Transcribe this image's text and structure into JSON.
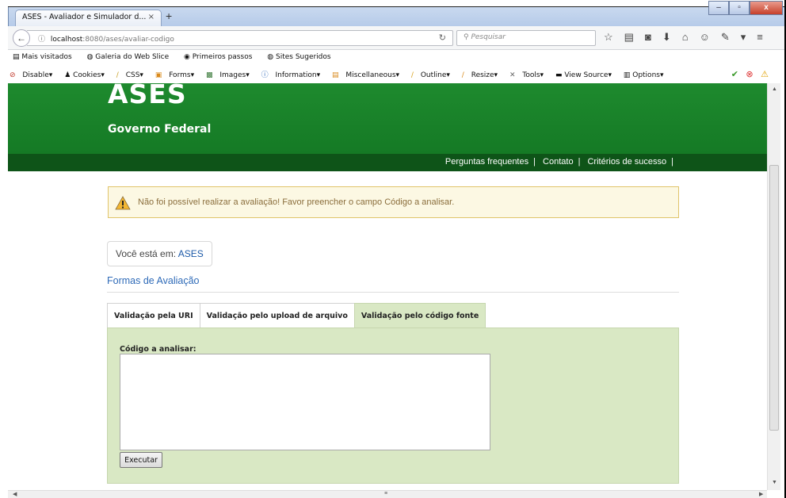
{
  "browser": {
    "tab_title": "ASES - Avaliador e Simulador d...",
    "tab_close": "×",
    "new_tab": "+",
    "window_buttons": {
      "minimize": "–",
      "maximize": "▫",
      "close": "x"
    },
    "url_host": "localhost",
    "url_rest": ":8080/ases/avaliar-codigo",
    "search_placeholder": "Pesquisar",
    "bookmarks": [
      "Mais visitados",
      "Galeria do Web Slice",
      "Primeiros passos",
      "Sites Sugeridos"
    ],
    "devtools": [
      "Disable▾",
      "Cookies▾",
      "CSS▾",
      "Forms▾",
      "Images▾",
      "Information▾",
      "Miscellaneous▾",
      "Outline▾",
      "Resize▾",
      "Tools▾",
      "View Source▾",
      "Options▾"
    ]
  },
  "site": {
    "title": "ASES",
    "subtitle": "Governo Federal",
    "nav": [
      "Perguntas frequentes",
      "Contato",
      "Critérios de sucesso"
    ]
  },
  "alert": {
    "message": "Não foi possível realizar a avaliação! Favor preencher o campo Código a analisar."
  },
  "breadcrumb": {
    "prefix": "Você está em: ",
    "link": "ASES"
  },
  "section": {
    "heading": "Formas de Avaliação"
  },
  "tabs": [
    "Validação pela URI",
    "Validação pelo upload de arquivo",
    "Validação pelo código fonte"
  ],
  "form": {
    "label": "Código a analisar:",
    "code_value": "",
    "button": "Executar"
  },
  "colors": {
    "header_green": "#1e8a2e",
    "nav_green": "#0e5418",
    "alert_bg": "#fcf8e3",
    "panel_bg": "#d9e8c4",
    "link_blue": "#2f6bb8"
  }
}
